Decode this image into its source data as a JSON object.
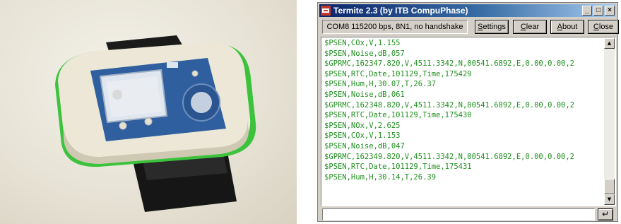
{
  "photo": {
    "subject": "wearable sensor device with strap"
  },
  "window": {
    "title": "Termite 2.3 (by ITB CompuPhase)",
    "controls": {
      "minimize": "_",
      "maximize": "□",
      "close": "×"
    }
  },
  "toolbar": {
    "status": "COM8 115200 bps, 8N1, no handshake",
    "settings": {
      "pre": "",
      "u": "S",
      "post": "ettings"
    },
    "clear": {
      "pre": "",
      "u": "C",
      "post": "lear"
    },
    "about": {
      "pre": "",
      "u": "A",
      "post": "bout"
    },
    "close": {
      "pre": "",
      "u": "C",
      "post": "lose"
    }
  },
  "log": {
    "lines": [
      "$PSEN,COx,V,1.155",
      "$PSEN,Noise,dB,057",
      "$GPRMC,162347.820,V,4511.3342,N,00541.6892,E,0.00,0.00,2",
      "$PSEN,RTC,Date,101129,Time,175429",
      "$PSEN,Hum,H,30.07,T,26.37",
      "$PSEN,Noise,dB,061",
      "$GPRMC,162348.820,V,4511.3342,N,00541.6892,E,0.00,0.00,2",
      "$PSEN,RTC,Date,101129,Time,175430",
      "$PSEN,NOx,V,2.625",
      "$PSEN,COx,V,1.153",
      "$PSEN,Noise,dB,047",
      "$GPRMC,162349.820,V,4511.3342,N,00541.6892,E,0.00,0.00,2",
      "$PSEN,RTC,Date,101129,Time,175431",
      "$PSEN,Hum,H,30.14,T,26.39"
    ],
    "text_color": "#1f8f1f",
    "scroll_position": 0.95
  },
  "input": {
    "value": "",
    "enter_icon": "↵"
  },
  "colors": {
    "titlebar_start": "#0a246a",
    "titlebar_end": "#a6caf0",
    "device_blue": "#2f5f9e"
  }
}
